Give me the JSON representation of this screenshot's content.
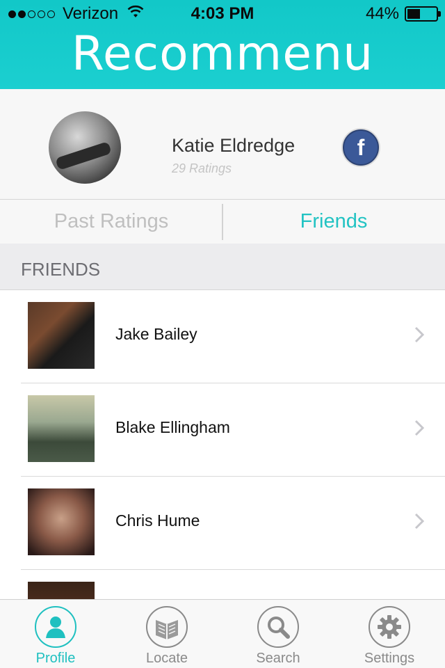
{
  "status_bar": {
    "carrier": "Verizon",
    "time": "4:03 PM",
    "battery": "44%",
    "signal_bars_filled": 2,
    "signal_bars_total": 5,
    "battery_level": 0.44
  },
  "header": {
    "app_title": "Recommenu",
    "accent_color": "#1bcfd0"
  },
  "profile": {
    "name": "Katie Eldredge",
    "ratings": "29 Ratings",
    "facebook_icon": "f"
  },
  "tabs": [
    {
      "label": "Past Ratings",
      "active": false
    },
    {
      "label": "Friends",
      "active": true
    }
  ],
  "section": {
    "title": "FRIENDS"
  },
  "friends": [
    {
      "name": "Jake Bailey"
    },
    {
      "name": "Blake Ellingham"
    },
    {
      "name": "Chris Hume"
    },
    {
      "name": ""
    }
  ],
  "tabbar": [
    {
      "label": "Profile",
      "icon": "person-icon",
      "selected": true
    },
    {
      "label": "Locate",
      "icon": "book-icon",
      "selected": false
    },
    {
      "label": "Search",
      "icon": "magnifier-icon",
      "selected": false
    },
    {
      "label": "Settings",
      "icon": "gear-icon",
      "selected": false
    }
  ]
}
